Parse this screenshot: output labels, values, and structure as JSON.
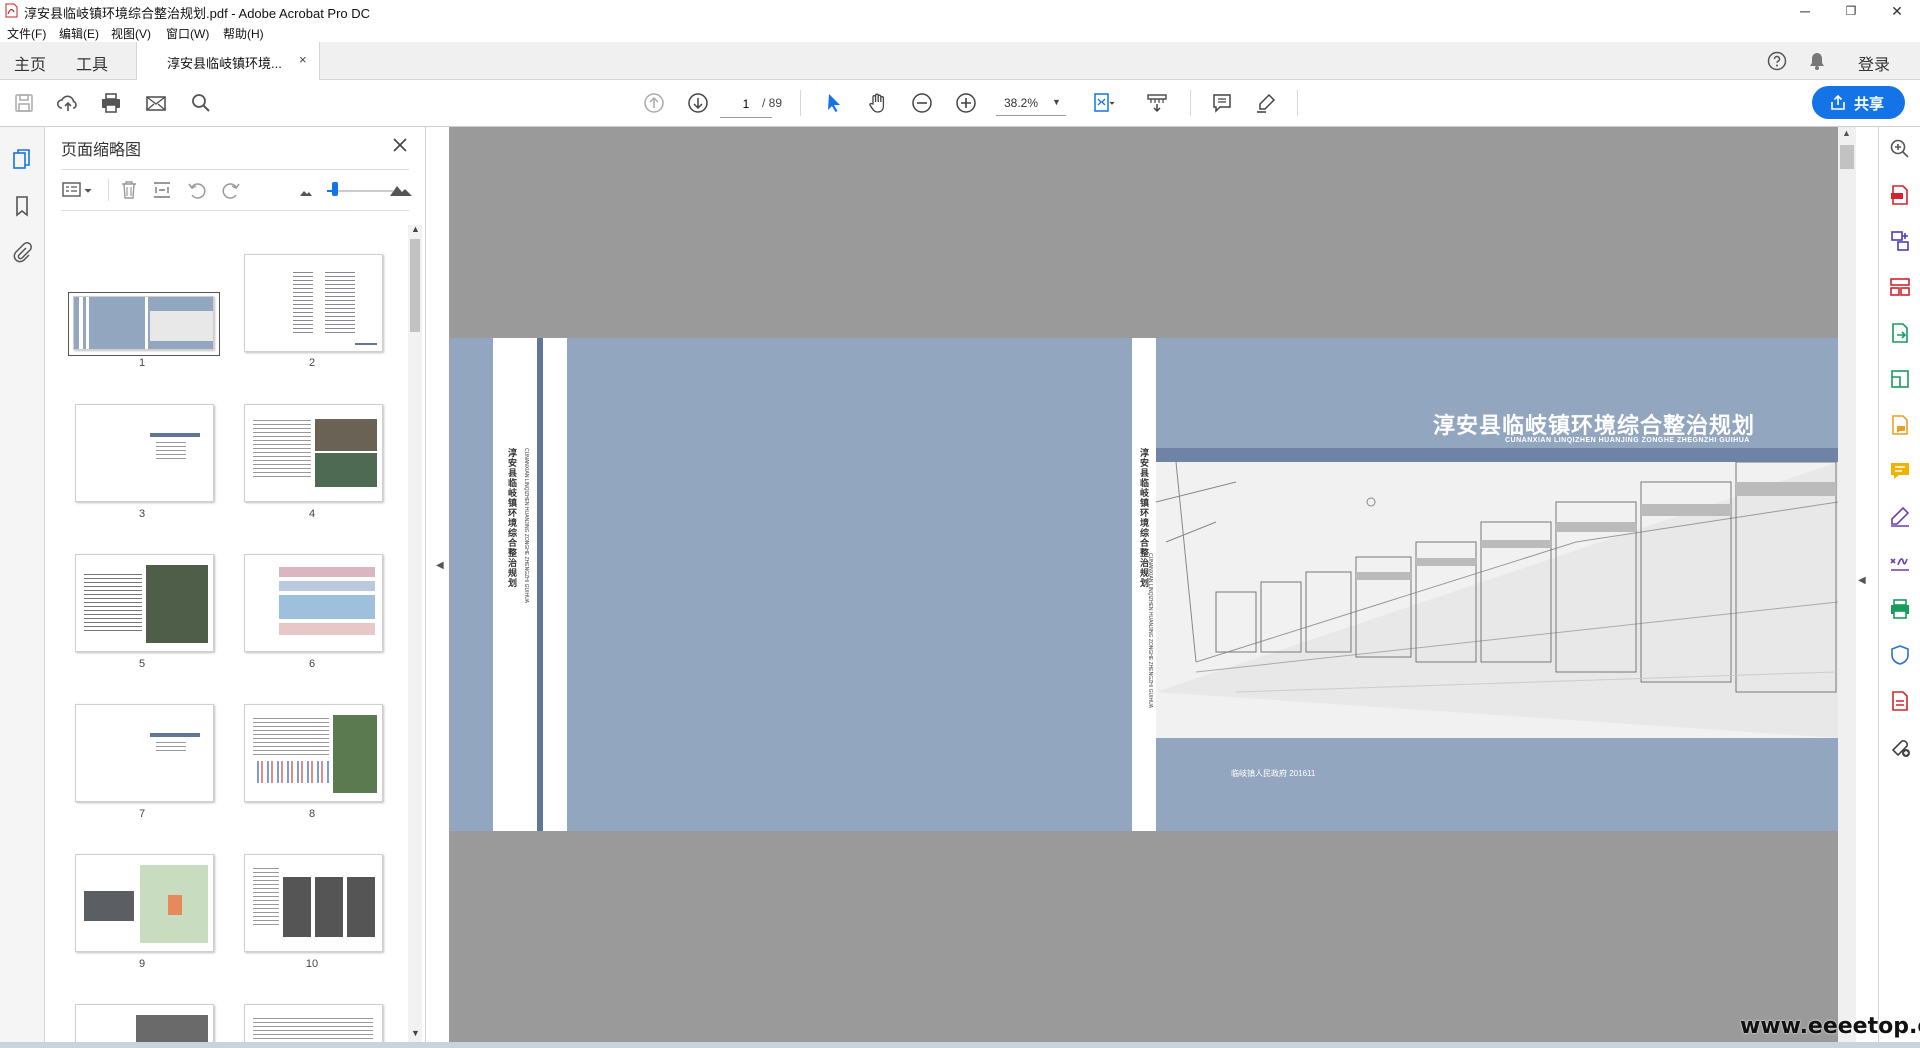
{
  "window": {
    "title": "淳安县临岐镇环境综合整治规划.pdf - Adobe Acrobat Pro DC",
    "minimize": "─",
    "maximize": "❐",
    "close": "✕"
  },
  "menu": [
    "文件(F)",
    "编辑(E)",
    "视图(V)",
    "窗口(W)",
    "帮助(H)"
  ],
  "nav": {
    "home": "主页",
    "tools": "工具",
    "login": "登录"
  },
  "tab": {
    "label": "淳安县临岐镇环境...",
    "close": "×"
  },
  "toolbar": {
    "page_current": "1",
    "page_total": "/ 89",
    "zoom": "38.2%",
    "share": "共享"
  },
  "panel": {
    "title": "页面缩略图",
    "thumbnails": [
      {
        "num": "1",
        "selected": true
      },
      {
        "num": "2"
      },
      {
        "num": "3"
      },
      {
        "num": "4"
      },
      {
        "num": "5"
      },
      {
        "num": "6"
      },
      {
        "num": "7"
      },
      {
        "num": "8"
      },
      {
        "num": "9"
      },
      {
        "num": "10"
      }
    ]
  },
  "document": {
    "cover_title": "淳安县临岐镇环境综合整治规划",
    "cover_subtitle": "CUNANXIAN  LINQIZHEN HUANJING ZONGHE ZHEGNZHI GUIHUA",
    "spine_cn": "淳安县临岐镇环境综合整治规划",
    "spine_en": "CUNANXIAN LINQIZHEN HUANJING ZONGHE ZHENGZHI GUIHUA",
    "publisher": "临岐镇人民政府    201611",
    "colors": {
      "cover_blue": "#93a6c0",
      "band_dark": "#6f84a5",
      "spine_line": "#5f7699"
    }
  },
  "watermark": "www.eeeetop.com",
  "icons": {
    "left_rail": [
      "pages-icon",
      "bookmark-icon",
      "attachment-icon"
    ],
    "right_rail": [
      "zoom-tool-icon",
      "create-pdf-icon",
      "combine-files-icon",
      "organize-pages-icon",
      "export-pdf-icon",
      "edit-pdf-icon",
      "send-for-comments-icon",
      "comment-icon",
      "fill-sign-icon",
      "send-for-signature-icon",
      "print-production-icon",
      "protect-icon",
      "pdf-standards-icon",
      "more-tools-icon"
    ]
  },
  "accent": "#1473e6"
}
